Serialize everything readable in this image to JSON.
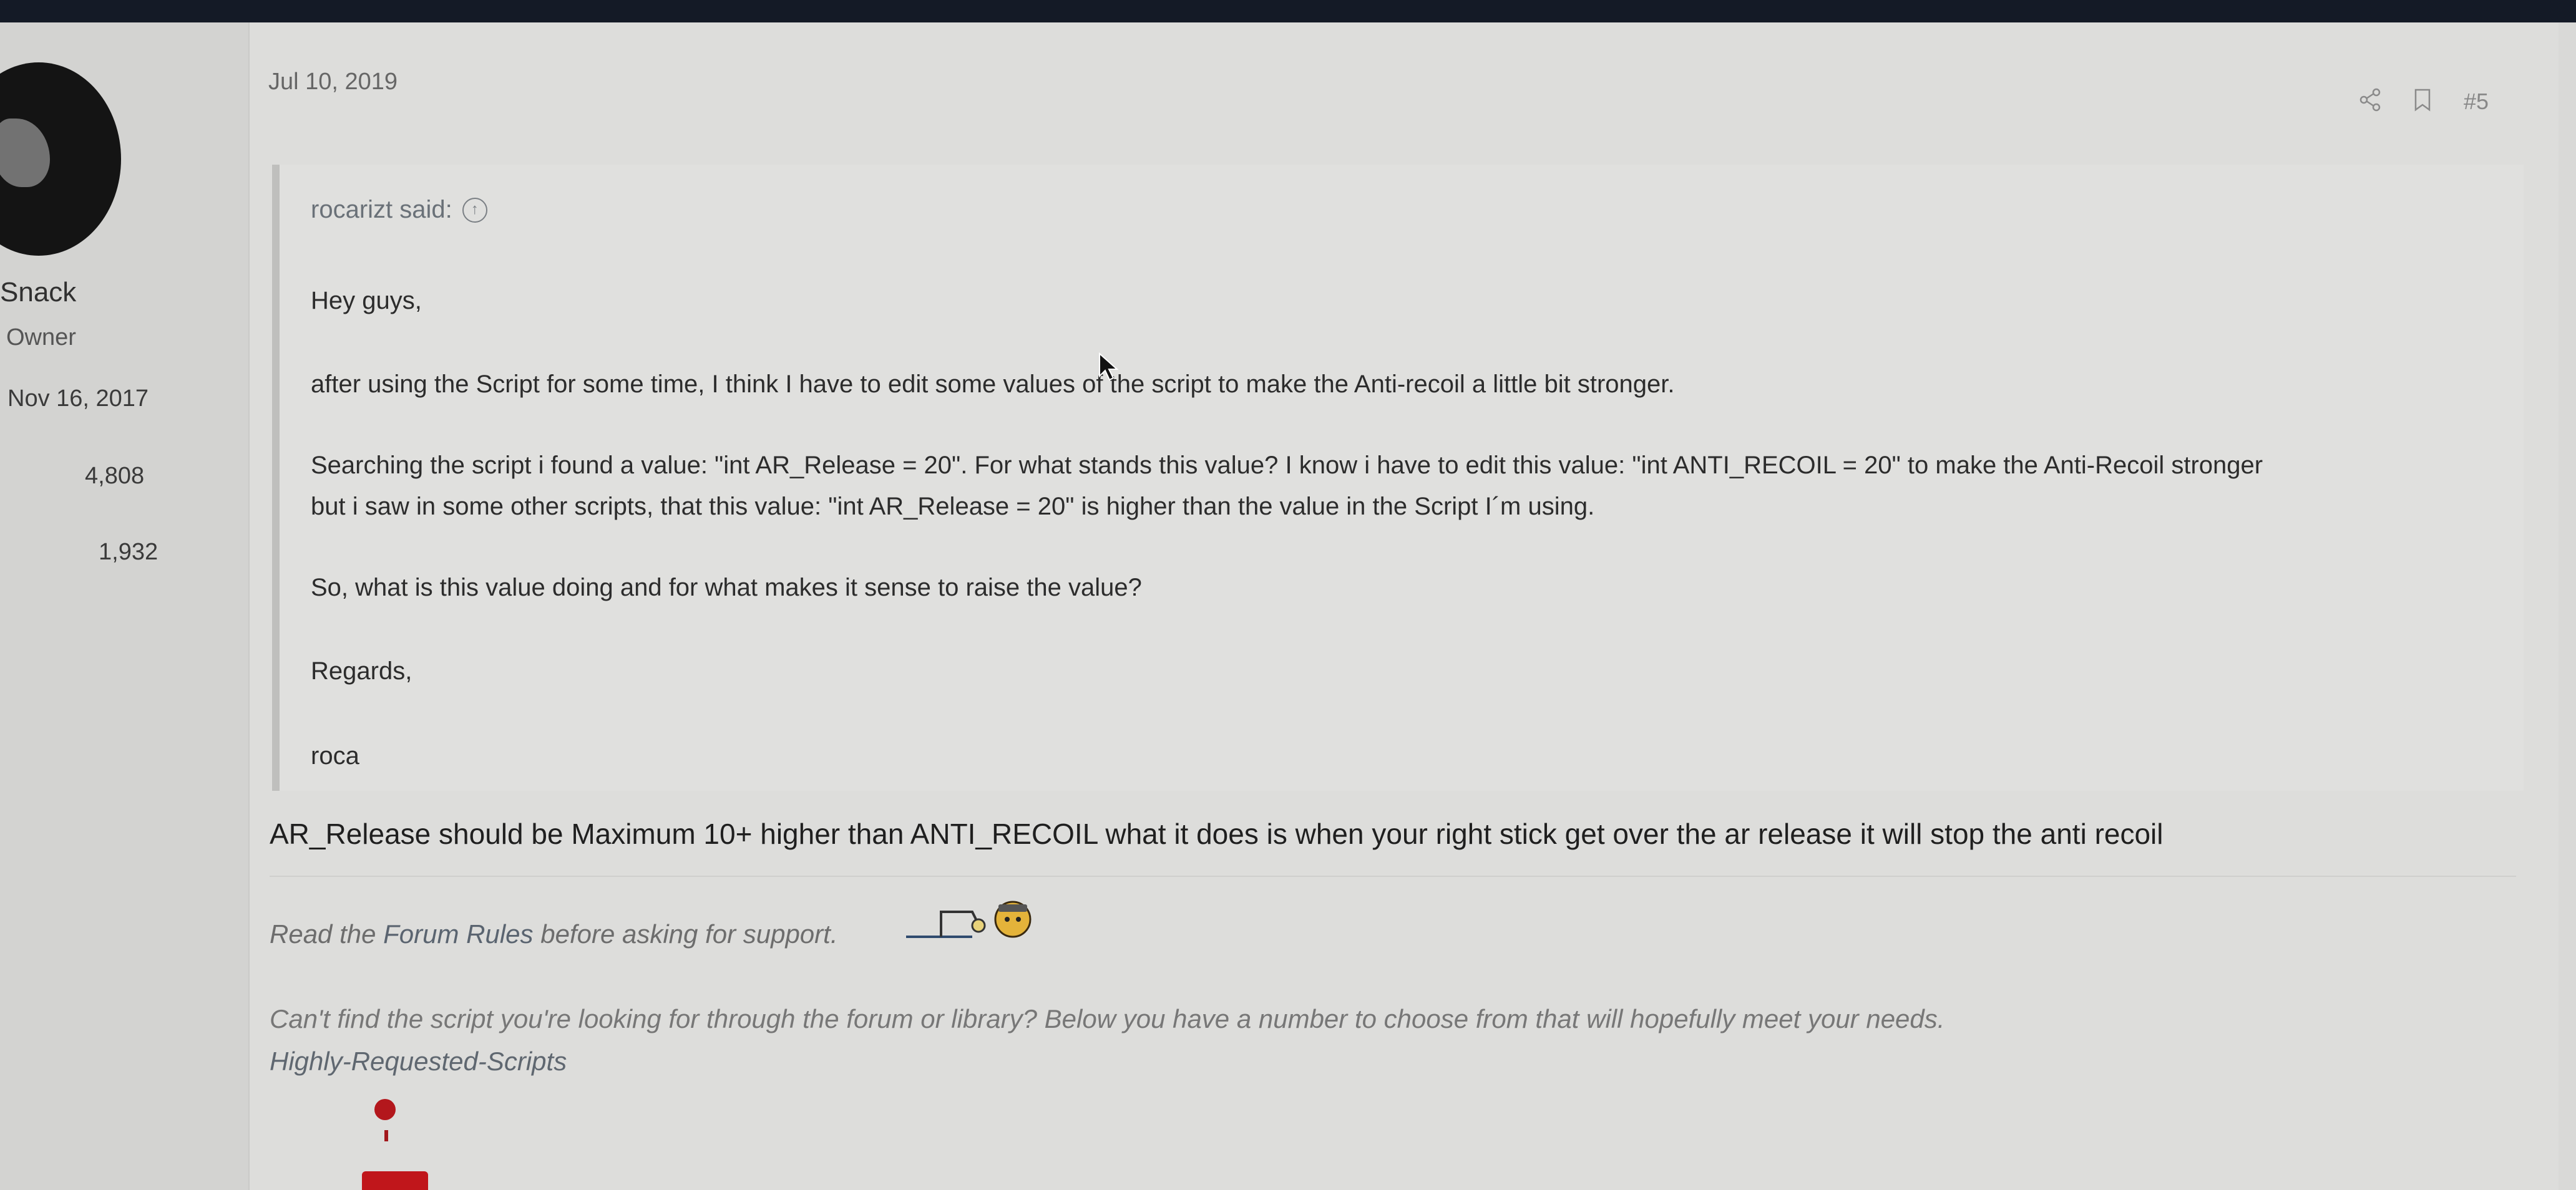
{
  "user": {
    "name": "Snack",
    "role": "Owner",
    "joined": "Nov 16, 2017",
    "messages": "4,808",
    "reactions": "1,932"
  },
  "post": {
    "date": "Jul 10, 2019",
    "number": "#5",
    "share_icon": "share-icon",
    "bookmark_icon": "bookmark-icon"
  },
  "quote": {
    "author_line": "rocarizt said:",
    "up_icon": "arrow-up-circle-icon",
    "lines": [
      "Hey guys,",
      "after using the Script for some time, I think I have to edit some values of the script to make the Anti-recoil a little bit stronger.",
      "Searching the script i found a value: \"int AR_Release = 20\". For what stands this value? I know i have to edit this value: \"int ANTI_RECOIL = 20\" to make the Anti-Recoil stronger",
      "but i saw in some other scripts, that this value: \"int AR_Release = 20\" is higher than the value in the Script I´m using.",
      "So, what is this value doing and for what makes it sense to raise the value?",
      "Regards,",
      "roca"
    ]
  },
  "reply": "AR_Release should be Maximum 10+ higher than ANTI_RECOIL what it does is when your right stick get over the ar release it will stop the anti recoil",
  "signature": {
    "read_prefix": "Read the ",
    "rules_link": "Forum Rules",
    "read_suffix": " before asking for support.",
    "cant_find": "Can't find the script you're looking for through the forum or library? Below you have a number to choose from that will hopefully meet your needs.",
    "requested_link": "Highly-Requested-Scripts"
  },
  "colors": {
    "topbar": "#141a26",
    "background": "#dddddb",
    "quote_border": "#bfbfbd",
    "accent_red": "#c0161b"
  }
}
